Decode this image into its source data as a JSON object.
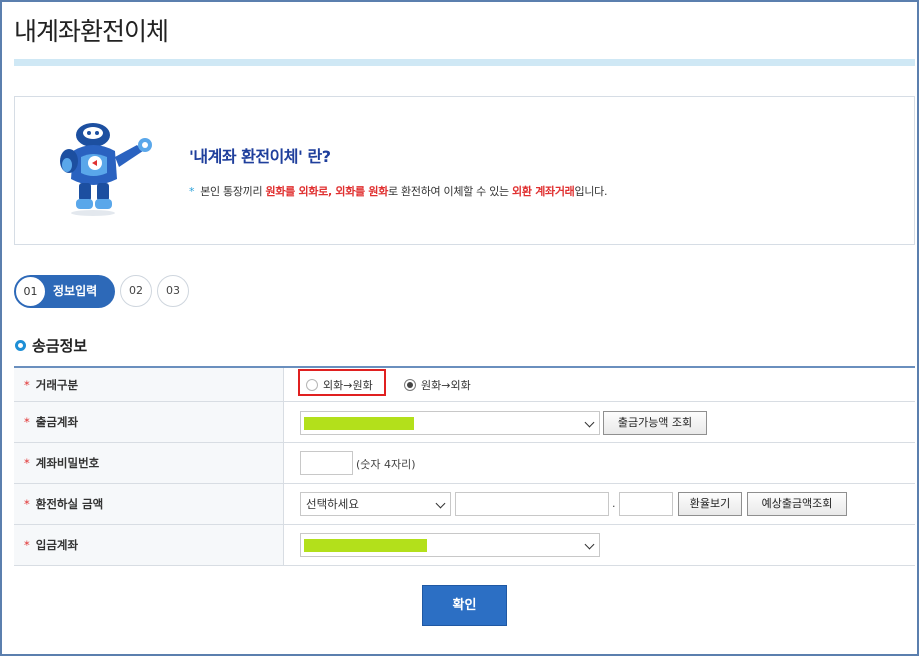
{
  "page": {
    "title": "내계좌환전이체"
  },
  "intro": {
    "heading": "'내계좌 환전이체' 란?",
    "bullet": "*",
    "desc_1": "본인 통장끼리 ",
    "desc_2": "원화를 외화로, 외화를 원화",
    "desc_3": "로 환전하여 이체할 수 있는 ",
    "desc_4": "외환 계좌거래",
    "desc_5": "입니다."
  },
  "steps": [
    {
      "num": "01",
      "label": "정보입력"
    },
    {
      "num": "02"
    },
    {
      "num": "03"
    }
  ],
  "section": {
    "title": "송금정보"
  },
  "form": {
    "required_mark": "*",
    "rows": [
      {
        "label": "거래구분"
      },
      {
        "label": "출금계좌"
      },
      {
        "label": "계좌비밀번호"
      },
      {
        "label": "환전하실 금액"
      },
      {
        "label": "입금계좌"
      }
    ],
    "trade_type": {
      "options": [
        "외화→원화",
        "원화→외화"
      ],
      "selected": "원화→외화"
    },
    "withdraw_account": {
      "check_button": "출금가능액 조회"
    },
    "password": {
      "hint": "(숫자 4자리)"
    },
    "amount": {
      "currency_select": "선택하세요",
      "decimal_dot": ".",
      "rate_button": "환율보기",
      "estimate_button": "예상출금액조회"
    }
  },
  "confirm_button": "확인",
  "colors": {
    "accent": "#2d69b8",
    "required": "#e03030",
    "masked": "#b3e01b",
    "highlight_box": "#e02020"
  }
}
